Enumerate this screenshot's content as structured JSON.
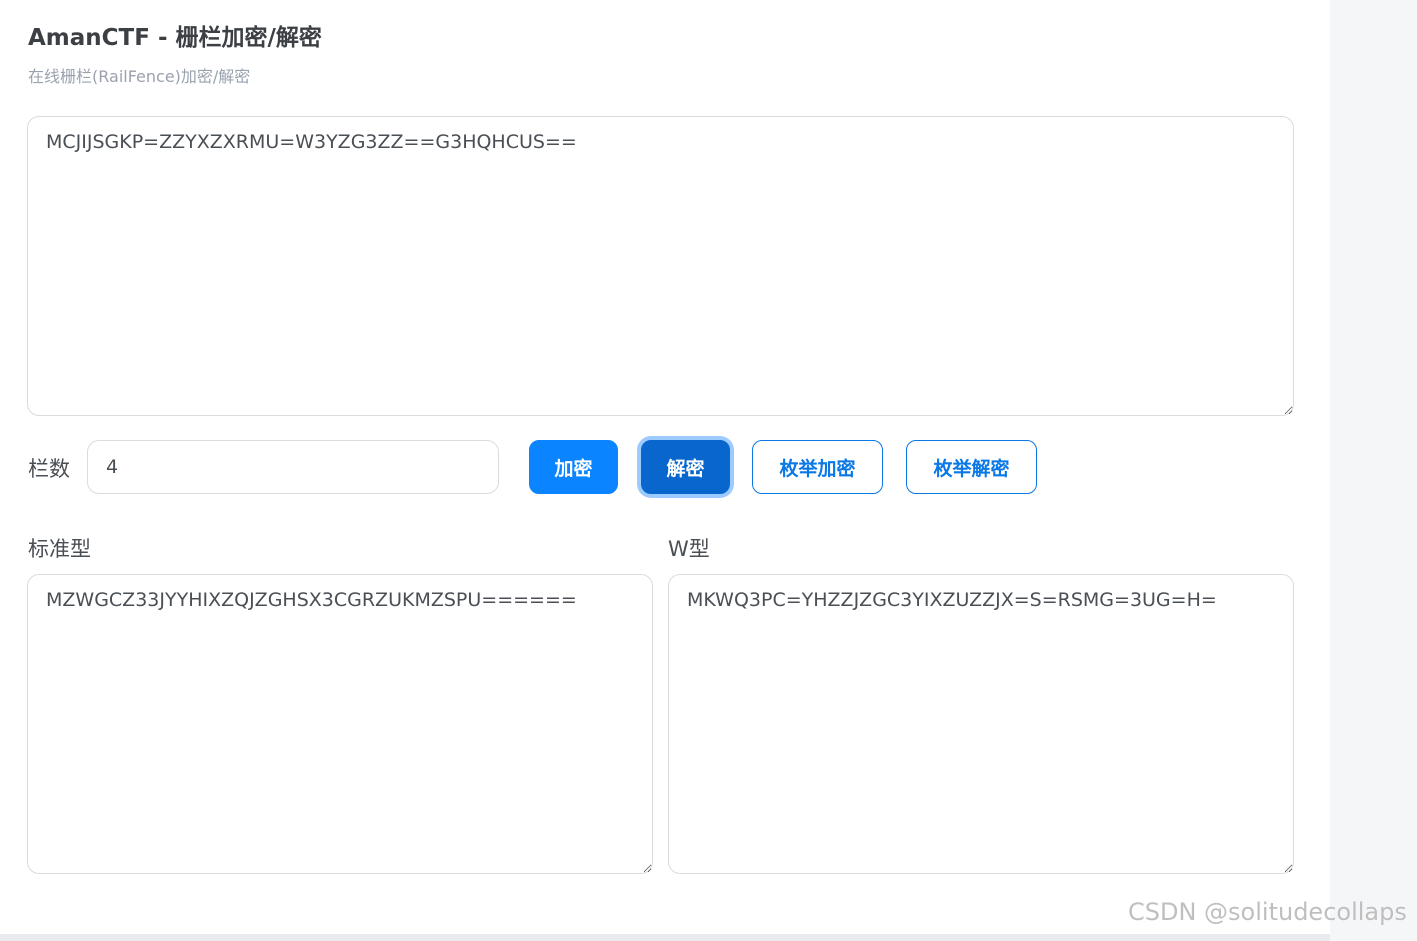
{
  "header": {
    "title": "AmanCTF - 栅栏加密/解密",
    "subtitle": "在线栅栏(RailFence)加密/解密"
  },
  "input": {
    "text": "MCJIJSGKP=ZZYXZXRMU=W3YZG3ZZ==G3HQHCUS=="
  },
  "controls": {
    "rails_label": "栏数",
    "rails_value": "4",
    "encrypt_label": "加密",
    "decrypt_label": "解密",
    "enum_encrypt_label": "枚举加密",
    "enum_decrypt_label": "枚举解密"
  },
  "outputs": {
    "standard_label": "标准型",
    "standard_text": "MZWGCZ33JYYHIXZQJZGHSX3CGRZUKMZSPU======",
    "w_label": "W型",
    "w_text": "MKWQ3PC=YHZZJZGC3YIXZUZZJX=S=RSMG=3UG=H="
  },
  "watermark": {
    "text": "CSDN @solitudecollaps"
  },
  "colors": {
    "primary": "#0a84ff",
    "primary_active": "#0866cc",
    "outline": "#0a78e6",
    "text": "#4a4f55",
    "muted": "#9aa2ae"
  }
}
